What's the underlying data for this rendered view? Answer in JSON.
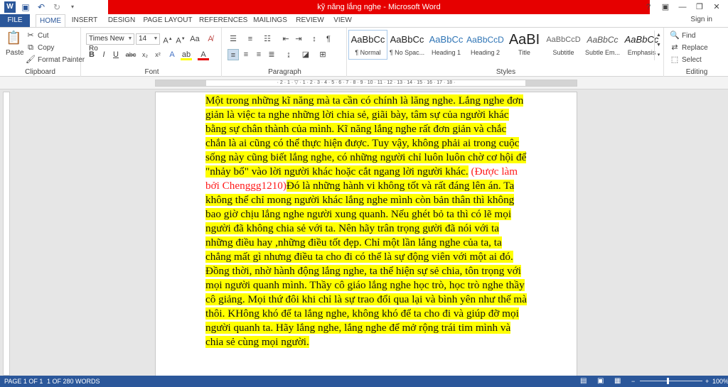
{
  "window": {
    "title": "kỹ năng lắng nghe - Microsoft Word"
  },
  "qat": {
    "icons": [
      "word-icon",
      "save-icon",
      "undo-icon",
      "redo-icon",
      "customize-icon"
    ]
  },
  "window_controls": {
    "help": "?",
    "ribbon_options": "▣",
    "minimize": "—",
    "restore": "❐",
    "close": "✕"
  },
  "tabs": [
    "FILE",
    "HOME",
    "INSERT",
    "DESIGN",
    "PAGE LAYOUT",
    "REFERENCES",
    "MAILINGS",
    "REVIEW",
    "VIEW"
  ],
  "signin": "Sign in",
  "clipboard": {
    "paste": "Paste",
    "cut": "Cut",
    "copy": "Copy",
    "format_painter": "Format Painter",
    "label": "Clipboard"
  },
  "font": {
    "name": "Times New Ro",
    "size": "14",
    "label": "Font"
  },
  "paragraph": {
    "label": "Paragraph"
  },
  "styles": {
    "label": "Styles",
    "items": [
      {
        "preview": "AaBbCc",
        "name": "¶ Normal"
      },
      {
        "preview": "AaBbCc",
        "name": "¶ No Spac..."
      },
      {
        "preview": "AaBbCc",
        "name": "Heading 1"
      },
      {
        "preview": "AaBbCcD",
        "name": "Heading 2"
      },
      {
        "preview": "AaBI",
        "name": "Title"
      },
      {
        "preview": "AaBbCcD",
        "name": "Subtitle"
      },
      {
        "preview": "AaBbCc",
        "name": "Subtle Em..."
      },
      {
        "preview": "AaBbCc",
        "name": "Emphasis"
      }
    ]
  },
  "editing": {
    "find": "Find",
    "replace": "Replace",
    "select": "Select",
    "label": "Editing"
  },
  "ruler": {
    "numbers": "· 2 · 1 · ▽ · 1 · 2 · 3 · 4 · 5 · 6 · 7 · 8 · 9 · 10 · 11 · 12 · 13 · 14 · 15 · 16 · 17 · 18 ·"
  },
  "document": {
    "part1": "Một trong những kĩ năng mà ta cần có chính là lăng nghe. Lắng nghe đơn giản là việc ta nghe những lời chia sẻ, giãi bày, tâm sự của người khác bằng sự chân thành của mình. Kĩ năng lắng nghe rất đơn giản và chắc chắn là ai cũng có thể thực hiện được. Tuy vậy, không phải ai trong cuộc sống này cũng biết lắng nghe, có những người chỉ luôn luôn chờ cơ hội để \"nhảy bổ\" vào lời người khác hoặc cắt ngang lời người khác.",
    "credit": "(Được làm bởi Chenggg1210)",
    "part2": "Đó là những hành vi không tốt và rất đáng lên án. Ta không thể chỉ mong người khác lắng nghe mình còn bản thân thì không bao giờ chịu lắng nghe người xung quanh. Nếu ghét bỏ ta thì có lẽ mọi người đã không chia sẻ với ta. Nên hãy trân trọng gười đã nói với ta những điều hay ,những điều tốt đẹp. Chỉ một lần lắng nghe của ta, ta chẳng mất gì nhưng điều ta cho đi có thể là sự động viên với một ai đó. Đồng thời, nhờ hành động lắng nghe, ta thể hiện sự sẻ chia, tôn trọng với mọi người quanh mình. Thầy cô giáo lắng nghe học trò, học trò nghe thầy cô giảng. Mọi thứ đôi khi chỉ là sự trao đổi qua lại và bình yên như thế mà thôi. KHông khó để ta lắng nghe, không khó để ta cho đi và giúp đỡ mọi người quanh ta. Hãy lắng nghe, lắng nghe để mở rộng trái tim mình và chia sẻ cùng mọi người."
  },
  "status": {
    "page": "PAGE 1 OF 1",
    "words": "1 OF 280 WORDS",
    "zoom": "100%",
    "zoom_out": "−",
    "zoom_in": "+"
  },
  "colors": {
    "word_blue": "#2b579a",
    "title_red": "#e60000",
    "highlight": "#ffff00",
    "credit_red": "#ff1a1a"
  }
}
